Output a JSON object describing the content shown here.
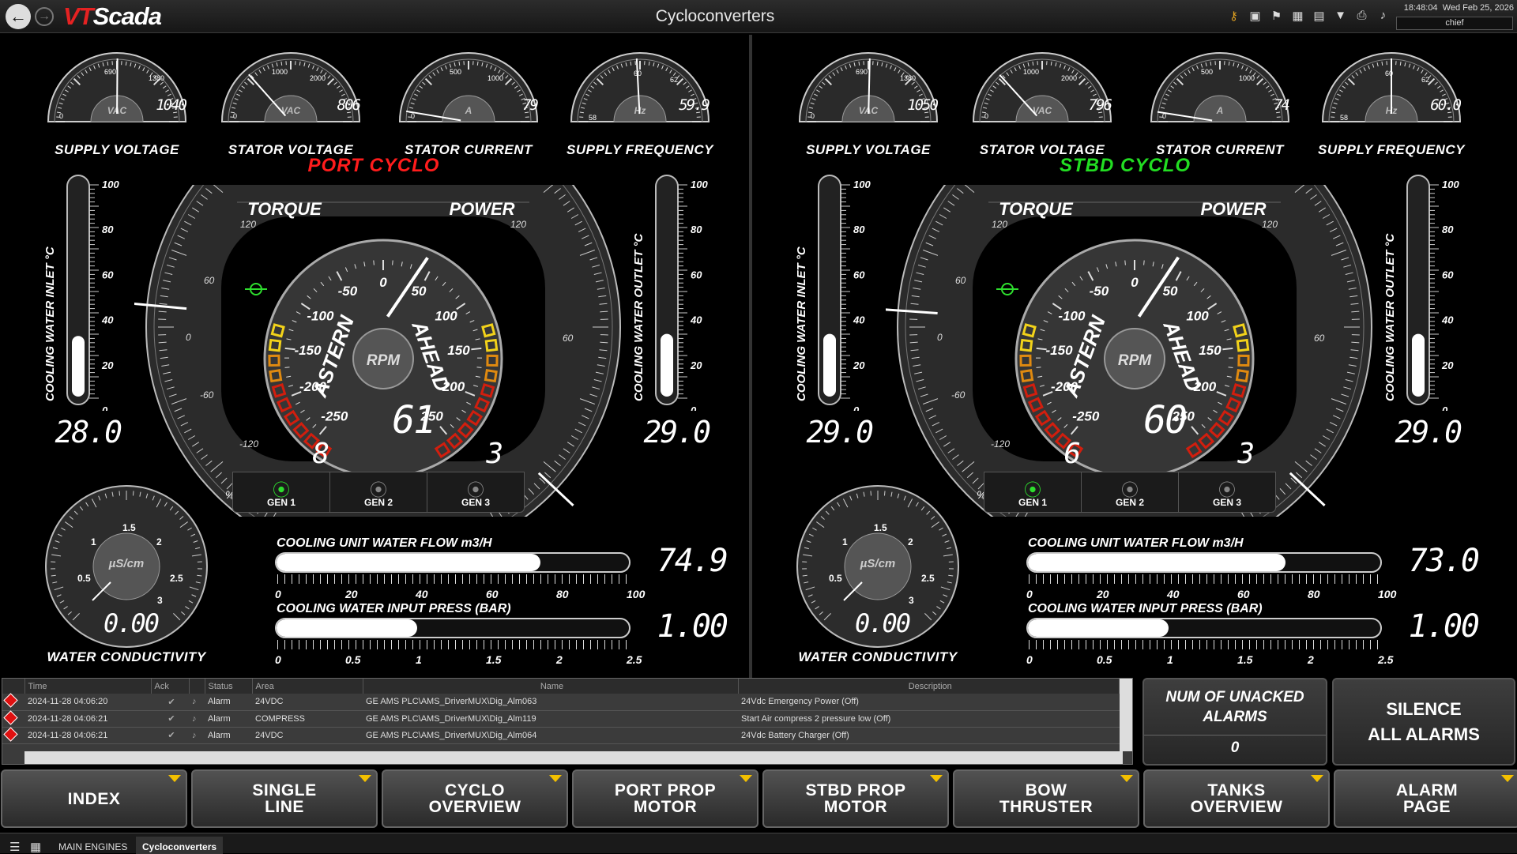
{
  "app": {
    "logo_vt": "VT",
    "logo_scada": "Scada",
    "title": "Cycloconverters",
    "time": "18:48:04",
    "date": "Wed Feb 25, 2026",
    "user": "chief"
  },
  "toolbar_icons": [
    "key-icon",
    "image-icon",
    "tag-icon",
    "hierarchy-icon",
    "spreadsheet-icon",
    "filter-icon",
    "printer-icon",
    "bell-icon"
  ],
  "labels": {
    "supply_voltage": "SUPPLY VOLTAGE",
    "stator_voltage": "STATOR VOLTAGE",
    "stator_current": "STATOR CURRENT",
    "supply_frequency": "SUPPLY FREQUENCY",
    "torque": "TORQUE",
    "power": "POWER",
    "astern": "ASTERN",
    "ahead": "AHEAD",
    "rpm": "RPM",
    "pct": "%",
    "inlet": "COOLING WATER INLET °C",
    "outlet": "COOLING WATER OUTLET °C",
    "conductivity": "WATER CONDUCTIVITY",
    "cond_unit": "µS/cm",
    "flow": "COOLING UNIT WATER FLOW m3/H",
    "press": "COOLING WATER INPUT PRESS (BAR)",
    "gen1": "GEN 1",
    "gen2": "GEN 2",
    "gen3": "GEN 3",
    "vac": "VAC",
    "amp": "A",
    "hz": "Hz"
  },
  "scales": {
    "thermo": [
      "100",
      "80",
      "60",
      "40",
      "20",
      "0"
    ],
    "flow": [
      "0",
      "20",
      "40",
      "60",
      "80",
      "100"
    ],
    "press": [
      "0",
      "0.5",
      "1",
      "1.5",
      "2",
      "2.5"
    ],
    "cond": [
      "0.5",
      "1",
      "1.5",
      "2",
      "2.5",
      "3"
    ],
    "rpm": [
      "-250",
      "-200",
      "-150",
      "-100",
      "-50",
      "0",
      "50",
      "100",
      "150",
      "200",
      "250"
    ],
    "torque": [
      "120",
      "60",
      "0",
      "-60",
      "-120"
    ],
    "power": [
      "120",
      "60"
    ],
    "supply_voltage": [
      "0",
      "690",
      "1380"
    ],
    "stator_voltage": [
      "0",
      "1000",
      "2000"
    ],
    "stator_current": [
      "0",
      "500",
      "1000"
    ],
    "supply_frequency": [
      "58",
      "60",
      "62"
    ]
  },
  "port": {
    "title": "PORT CYCLO",
    "title_color": "#ff1c1c",
    "supply_voltage": "1040",
    "stator_voltage": "806",
    "stator_current": "79",
    "supply_frequency": "59.9",
    "inlet_temp": "28.0",
    "outlet_temp": "29.0",
    "inlet_level": 0.27,
    "outlet_level": 0.28,
    "rpm": "61",
    "torque": "8",
    "power": "3",
    "conductivity": "0.00",
    "flow": "74.9",
    "flow_level": 0.749,
    "press": "1.00",
    "press_level": 0.4,
    "active_gen": 1
  },
  "stbd": {
    "title": "STBD CYCLO",
    "title_color": "#22dd22",
    "supply_voltage": "1050",
    "stator_voltage": "796",
    "stator_current": "74",
    "supply_frequency": "60.0",
    "inlet_temp": "29.0",
    "outlet_temp": "29.0",
    "inlet_level": 0.28,
    "outlet_level": 0.28,
    "rpm": "60",
    "torque": "6",
    "power": "3",
    "conductivity": "0.00",
    "flow": "73.0",
    "flow_level": 0.73,
    "press": "1.00",
    "press_level": 0.4,
    "active_gen": 1
  },
  "alarms": {
    "columns": [
      "Time",
      "Ack",
      "Status",
      "Area",
      "Name",
      "Description"
    ],
    "rows": [
      {
        "time": "2024-11-28  04:06:20",
        "status": "Alarm",
        "area": "24VDC",
        "name": "GE AMS PLC\\AMS_DriverMUX\\Dig_Alm063",
        "desc": "24Vdc Emergency Power (Off)"
      },
      {
        "time": "2024-11-28  04:06:21",
        "status": "Alarm",
        "area": "COMPRESS",
        "name": "GE AMS PLC\\AMS_DriverMUX\\Dig_Alm119",
        "desc": "Start Air compress 2 pressure low (Off)"
      },
      {
        "time": "2024-11-28  04:06:21",
        "status": "Alarm",
        "area": "24VDC",
        "name": "GE AMS PLC\\AMS_DriverMUX\\Dig_Alm064",
        "desc": "24Vdc Battery Charger (Off)"
      }
    ],
    "unacked_label": "NUM OF UNACKED ALARMS",
    "unacked_count": "0",
    "silence_label_1": "SILENCE",
    "silence_label_2": "ALL ALARMS"
  },
  "nav": [
    [
      "INDEX",
      ""
    ],
    [
      "SINGLE",
      "LINE"
    ],
    [
      "CYCLO",
      "OVERVIEW"
    ],
    [
      "PORT PROP",
      "MOTOR"
    ],
    [
      "STBD PROP",
      "MOTOR"
    ],
    [
      "BOW",
      "THRUSTER"
    ],
    [
      "TANKS",
      "OVERVIEW"
    ],
    [
      "ALARM",
      "PAGE"
    ]
  ],
  "tabs": [
    "MAIN ENGINES",
    "Cycloconverters"
  ]
}
